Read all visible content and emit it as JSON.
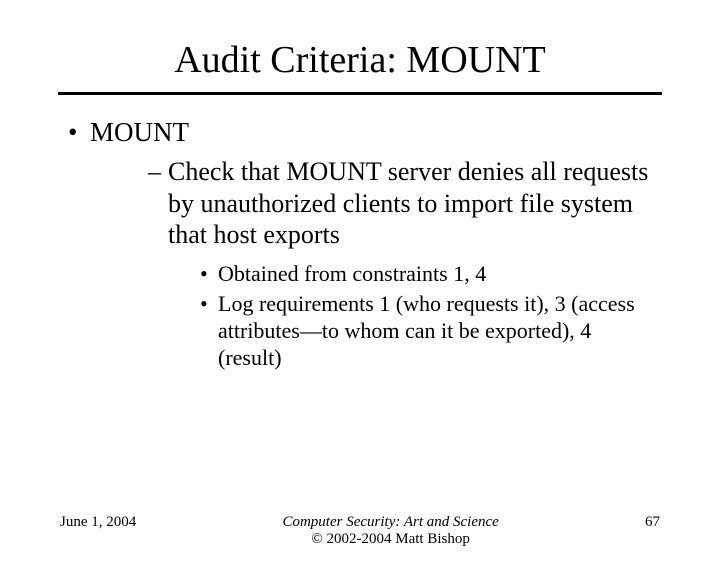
{
  "title": "Audit Criteria: MOUNT",
  "bullets": {
    "level1": [
      {
        "text": "MOUNT"
      }
    ],
    "level2": [
      {
        "text": "Check that MOUNT server denies all requests by unauthorized clients to import file system that host exports"
      }
    ],
    "level3": [
      {
        "text": "Obtained from constraints 1, 4"
      },
      {
        "text": "Log requirements 1 (who requests it), 3 (access attributes—to whom can it be exported), 4 (result)"
      }
    ]
  },
  "footer": {
    "date": "June 1, 2004",
    "book": "Computer Security: Art and Science",
    "copyright": "© 2002-2004 Matt Bishop",
    "page": "67"
  }
}
